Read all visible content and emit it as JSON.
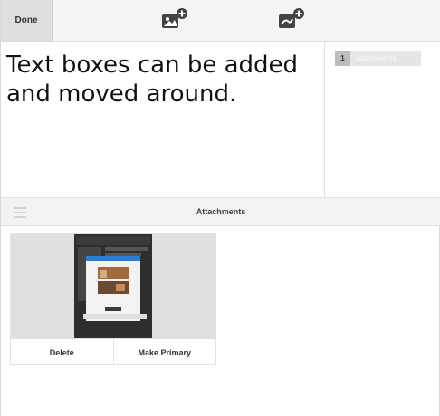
{
  "toolbar": {
    "done_label": "Done",
    "add_image_icon": "add-image-icon",
    "add_other_icon": "add-attachment-icon"
  },
  "editor": {
    "text": "Text boxes can be added and moved around."
  },
  "side_panel": {
    "tab_count": "1",
    "tab_label": "Attachments"
  },
  "attachments": {
    "title": "Attachments",
    "items": [
      {
        "delete_label": "Delete",
        "primary_label": "Make Primary"
      }
    ]
  },
  "colors": {
    "toolbar_bg": "#f4f4f4",
    "done_bg": "#dedede",
    "icon": "#444444"
  }
}
